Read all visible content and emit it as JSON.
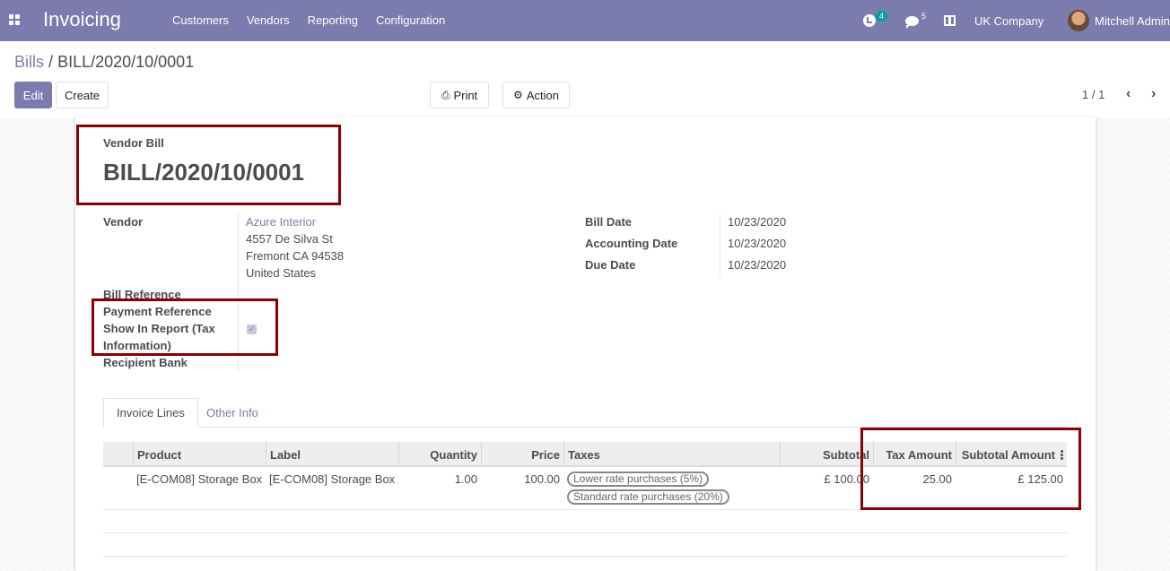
{
  "navbar": {
    "app_title": "Invoicing",
    "menu": [
      "Customers",
      "Vendors",
      "Reporting",
      "Configuration"
    ],
    "activity_count": "4",
    "message_count": "5",
    "company": "UK Company",
    "user": "Mitchell Admin",
    "color": "#7c7bad"
  },
  "breadcrumb": {
    "parent": "Bills",
    "separator": "/",
    "current": "BILL/2020/10/0001"
  },
  "buttons": {
    "edit": "Edit",
    "create": "Create",
    "print": "Print",
    "action": "Action"
  },
  "pager": {
    "value": "1 / 1"
  },
  "form": {
    "doc_type": "Vendor Bill",
    "doc_number": "BILL/2020/10/0001",
    "vendor_label": "Vendor",
    "vendor_name": "Azure Interior",
    "vendor_address": [
      "4557 De Silva St",
      "Fremont CA 94538",
      "United States"
    ],
    "bill_reference_label": "Bill Reference",
    "payment_reference_label": "Payment Reference",
    "show_in_report_label_1": "Show In Report (Tax",
    "show_in_report_label_2": "Information)",
    "show_in_report_checked": true,
    "recipient_bank_label": "Recipient Bank",
    "bill_date_label": "Bill Date",
    "bill_date": "10/23/2020",
    "accounting_date_label": "Accounting Date",
    "accounting_date": "10/23/2020",
    "due_date_label": "Due Date",
    "due_date": "10/23/2020"
  },
  "tabs": [
    "Invoice Lines",
    "Other Info"
  ],
  "table": {
    "columns": [
      "Product",
      "Label",
      "Quantity",
      "Price",
      "Taxes",
      "Subtotal",
      "Tax Amount",
      "Subtotal Amount"
    ],
    "rows": [
      {
        "product": "[E-COM08] Storage Box",
        "label": "[E-COM08] Storage Box",
        "quantity": "1.00",
        "price": "100.00",
        "taxes": [
          "Lower rate purchases (5%)",
          "Standard rate purchases (20%)"
        ],
        "subtotal": "£ 100.00",
        "tax_amount": "25.00",
        "subtotal_amount": "£ 125.00"
      }
    ]
  }
}
